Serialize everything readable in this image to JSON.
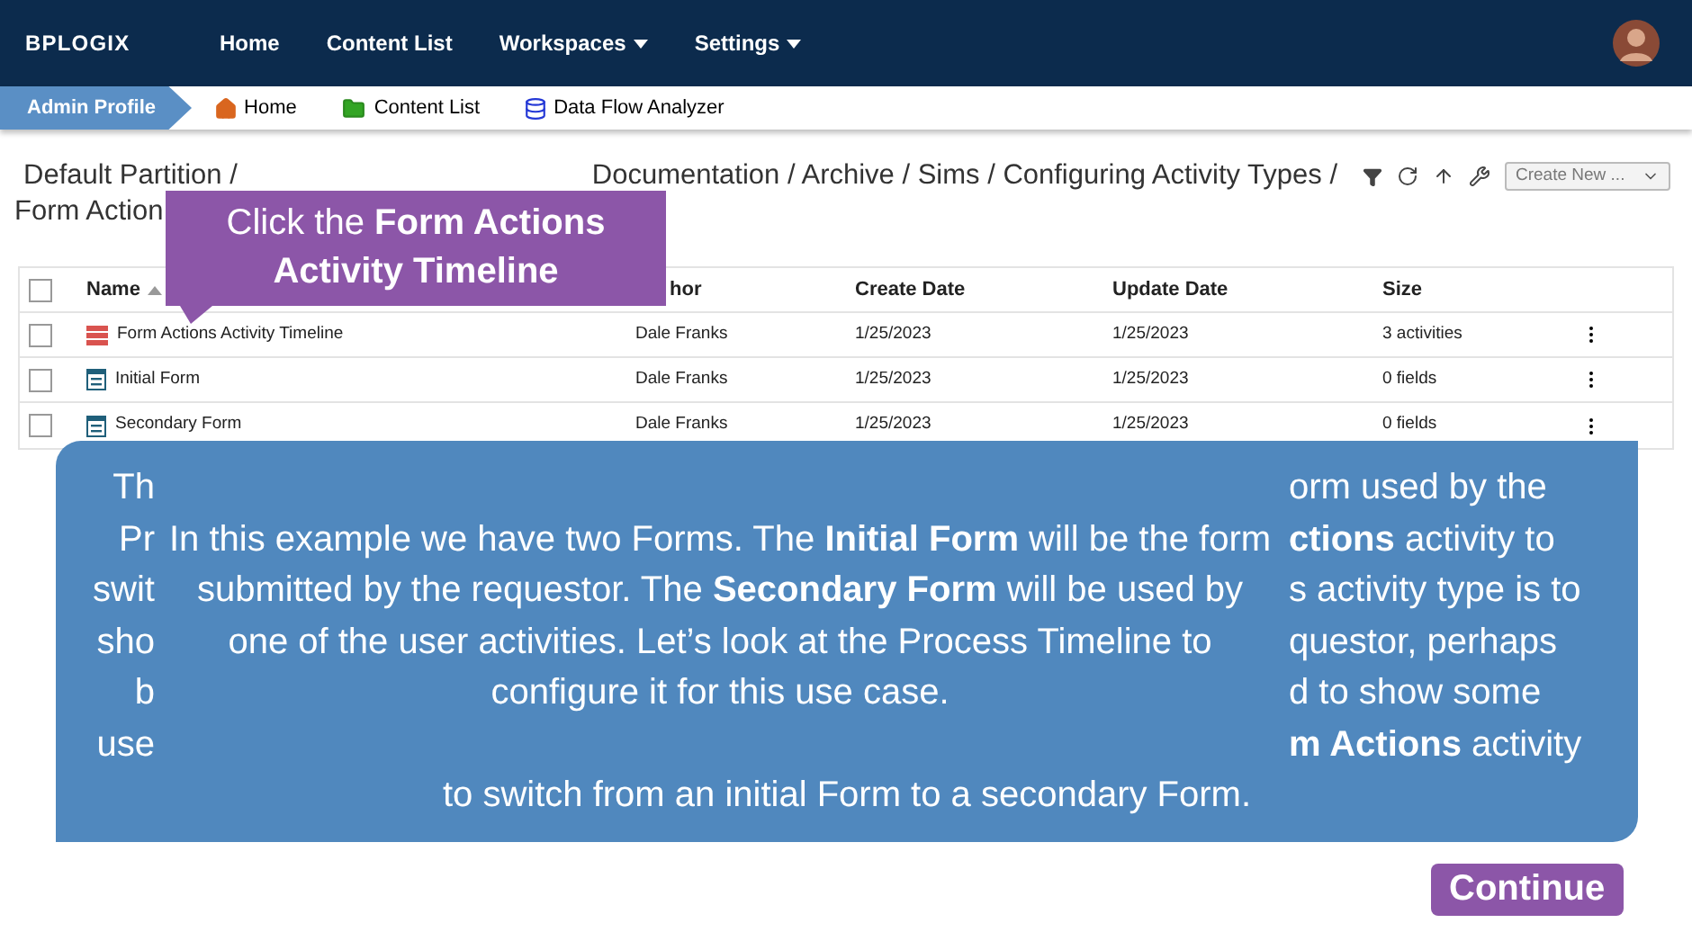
{
  "header": {
    "logo": "BPLOGIX",
    "nav": [
      {
        "label": "Home",
        "dropdown": false
      },
      {
        "label": "Content List",
        "dropdown": false
      },
      {
        "label": "Workspaces",
        "dropdown": true
      },
      {
        "label": "Settings",
        "dropdown": true
      }
    ]
  },
  "quick_bar": {
    "profile": "Admin Profile",
    "links": [
      {
        "label": "Home",
        "kind": "home"
      },
      {
        "label": "Content List",
        "kind": "folder"
      },
      {
        "label": "Data Flow Analyzer",
        "kind": "database"
      }
    ]
  },
  "breadcrumb": {
    "first": "Default Partition /",
    "rest": "Documentation / Archive / Sims / Configuring Activity Types /",
    "line2": "Form Action"
  },
  "toolbar": {
    "create_button": "Create New ..."
  },
  "table": {
    "select_all_checked": false,
    "columns": [
      {
        "label": "Name",
        "sorted": true
      },
      {
        "label": "hor",
        "sorted": false
      },
      {
        "label": "Create Date",
        "sorted": false
      },
      {
        "label": "Update Date",
        "sorted": false
      },
      {
        "label": "Size",
        "sorted": false
      }
    ],
    "rows": [
      {
        "kind": "timeline",
        "name": "Form Actions Activity Timeline",
        "author": "Dale Franks",
        "created": "1/25/2023",
        "updated": "1/25/2023",
        "size": "3 activities",
        "checked": false
      },
      {
        "kind": "form",
        "name": "Initial Form",
        "author": "Dale Franks",
        "created": "1/25/2023",
        "updated": "1/25/2023",
        "size": "0 fields",
        "checked": false
      },
      {
        "kind": "form",
        "name": "Secondary Form",
        "author": "Dale Franks",
        "created": "1/25/2023",
        "updated": "1/25/2023",
        "size": "0 fields",
        "checked": false
      }
    ]
  },
  "callout": {
    "text": "Click the **Form Actions Activity Timeline**"
  },
  "overlay": {
    "row1": {
      "left": "Th",
      "right": "orm used by the"
    },
    "middle_left": [
      "Pr",
      "swit",
      "sho",
      "b"
    ],
    "middle_right": [
      "**ctions** activity to",
      "s activity type is to",
      "questor, perhaps",
      "d to show some"
    ],
    "inner_text": "In this example we have two Forms. The **Initial Form** will be the form submitted by the requestor. The **Secondary Form** will be used by one of the user activities. Let’s look at the Process Timeline to configure it for this use case.",
    "row6": {
      "left": "use",
      "right": "**m Actions** activity"
    },
    "last_line": "to switch from an initial Form to a secondary Form."
  },
  "continue_button": "Continue"
}
